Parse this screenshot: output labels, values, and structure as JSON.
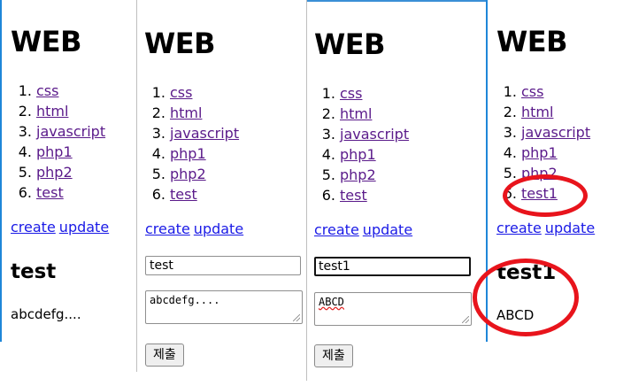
{
  "site_title": "WEB",
  "nav_items": [
    {
      "num": "1.",
      "label": "css"
    },
    {
      "num": "2.",
      "label": "html"
    },
    {
      "num": "3.",
      "label": "javascript"
    },
    {
      "num": "4.",
      "label": "php1"
    },
    {
      "num": "5.",
      "label": "php2"
    },
    {
      "num": "6.",
      "label": "test"
    }
  ],
  "create_label": "create",
  "update_label": "update",
  "panel1": {
    "heading": "test",
    "description": "abcdefg...."
  },
  "panel2": {
    "title_value": "test",
    "description_value": "abcdefg....",
    "submit_label": "제출"
  },
  "panel3": {
    "title_value": "test1",
    "description_value": "ABCD",
    "submit_label": "제출"
  },
  "panel4": {
    "last_item_label": "test1",
    "heading": "test1",
    "description": "ABCD"
  },
  "colors": {
    "visited_link": "#5a1a8a",
    "link": "#1a1ae6",
    "annotation_ring": "#e8141c",
    "divider": "#1e86d8"
  }
}
